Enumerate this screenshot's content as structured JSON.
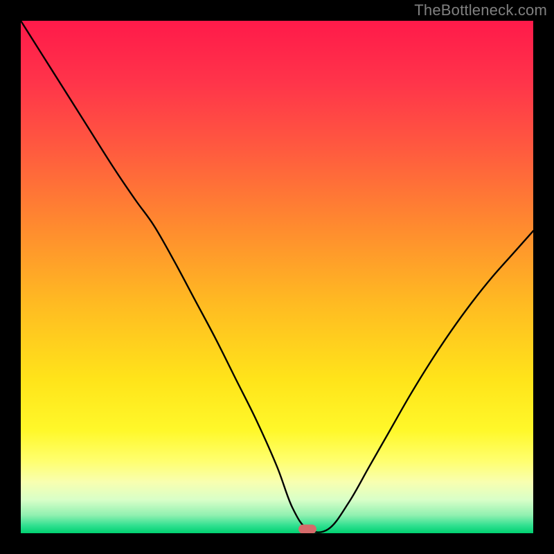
{
  "watermark": "TheBottleneck.com",
  "gradient": {
    "stops": [
      {
        "offset": 0.0,
        "color": "#ff1a4a"
      },
      {
        "offset": 0.12,
        "color": "#ff344a"
      },
      {
        "offset": 0.25,
        "color": "#ff5a3f"
      },
      {
        "offset": 0.4,
        "color": "#ff8a2f"
      },
      {
        "offset": 0.55,
        "color": "#ffba22"
      },
      {
        "offset": 0.7,
        "color": "#ffe41a"
      },
      {
        "offset": 0.8,
        "color": "#fff82a"
      },
      {
        "offset": 0.86,
        "color": "#ffff70"
      },
      {
        "offset": 0.9,
        "color": "#f8ffb0"
      },
      {
        "offset": 0.935,
        "color": "#d8ffc8"
      },
      {
        "offset": 0.965,
        "color": "#90f0b0"
      },
      {
        "offset": 0.985,
        "color": "#30e090"
      },
      {
        "offset": 1.0,
        "color": "#00d070"
      }
    ]
  },
  "marker": {
    "x_frac": 0.56,
    "y_frac": 0.992
  },
  "chart_data": {
    "type": "line",
    "title": "",
    "xlabel": "",
    "ylabel": "",
    "x_range": [
      0,
      1
    ],
    "y_range": [
      0,
      1
    ],
    "series": [
      {
        "name": "bottleneck-curve",
        "x": [
          0.0,
          0.06,
          0.12,
          0.18,
          0.224,
          0.26,
          0.3,
          0.34,
          0.38,
          0.42,
          0.46,
          0.5,
          0.53,
          0.56,
          0.6,
          0.64,
          0.68,
          0.72,
          0.76,
          0.8,
          0.84,
          0.88,
          0.92,
          0.96,
          1.0
        ],
        "y": [
          1.0,
          0.905,
          0.81,
          0.715,
          0.65,
          0.6,
          0.53,
          0.455,
          0.38,
          0.3,
          0.22,
          0.13,
          0.05,
          0.008,
          0.008,
          0.06,
          0.13,
          0.2,
          0.27,
          0.335,
          0.395,
          0.45,
          0.5,
          0.545,
          0.59
        ]
      }
    ],
    "minimum": {
      "x": 0.56,
      "y": 0.008
    },
    "background_meaning": "vertical gradient red (top=bad) → yellow → green (bottom=good)"
  }
}
